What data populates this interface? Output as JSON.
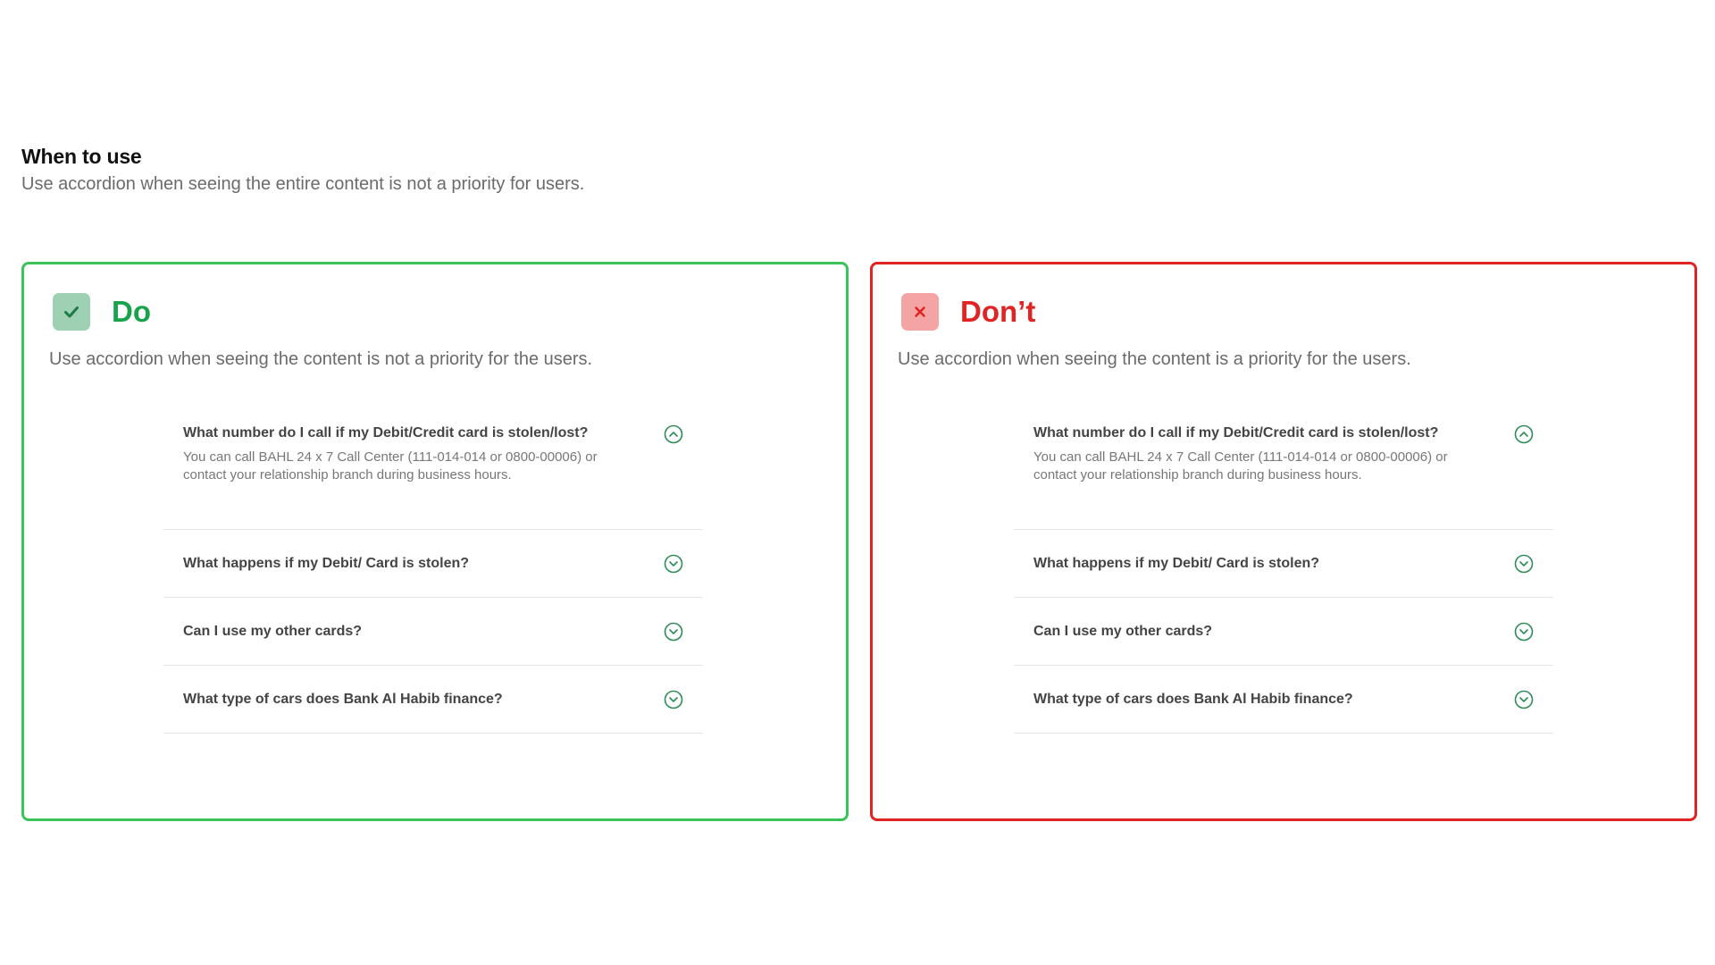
{
  "header": {
    "title": "When to use",
    "subtitle": "Use accordion when seeing the entire content is not a priority for users."
  },
  "colors": {
    "do": "#16a34a",
    "dont": "#e02424",
    "accent_icon": "#2e8b57"
  },
  "do_panel": {
    "title": "Do",
    "icon": "check-icon",
    "description": "Use accordion when seeing the content is not a priority for the users.",
    "items": [
      {
        "question": "What number do I call if my Debit/Credit card is stolen/lost?",
        "answer_line1": "You can call BAHL 24 x 7 Call Center (111-014-014 or 0800-00006) or",
        "answer_line2": "contact your relationship branch during business hours.",
        "expanded": true
      },
      {
        "question": "What happens if my Debit/ Card is stolen?",
        "expanded": false
      },
      {
        "question": "Can I use my other cards?",
        "expanded": false
      },
      {
        "question": "What type of cars does Bank Al Habib finance?",
        "expanded": false
      }
    ]
  },
  "dont_panel": {
    "title": "Don’t",
    "icon": "close-icon",
    "description": "Use accordion when seeing the content is a priority for the users.",
    "items": [
      {
        "question": "What number do I call if my Debit/Credit card is stolen/lost?",
        "answer_line1": "You can call BAHL 24 x 7 Call Center (111-014-014 or 0800-00006) or",
        "answer_line2": "contact your relationship branch during business hours.",
        "expanded": true
      },
      {
        "question": "What happens if my Debit/ Card is stolen?",
        "expanded": false
      },
      {
        "question": "Can I use my other cards?",
        "expanded": false
      },
      {
        "question": "What type of cars does Bank Al Habib finance?",
        "expanded": false
      }
    ]
  }
}
